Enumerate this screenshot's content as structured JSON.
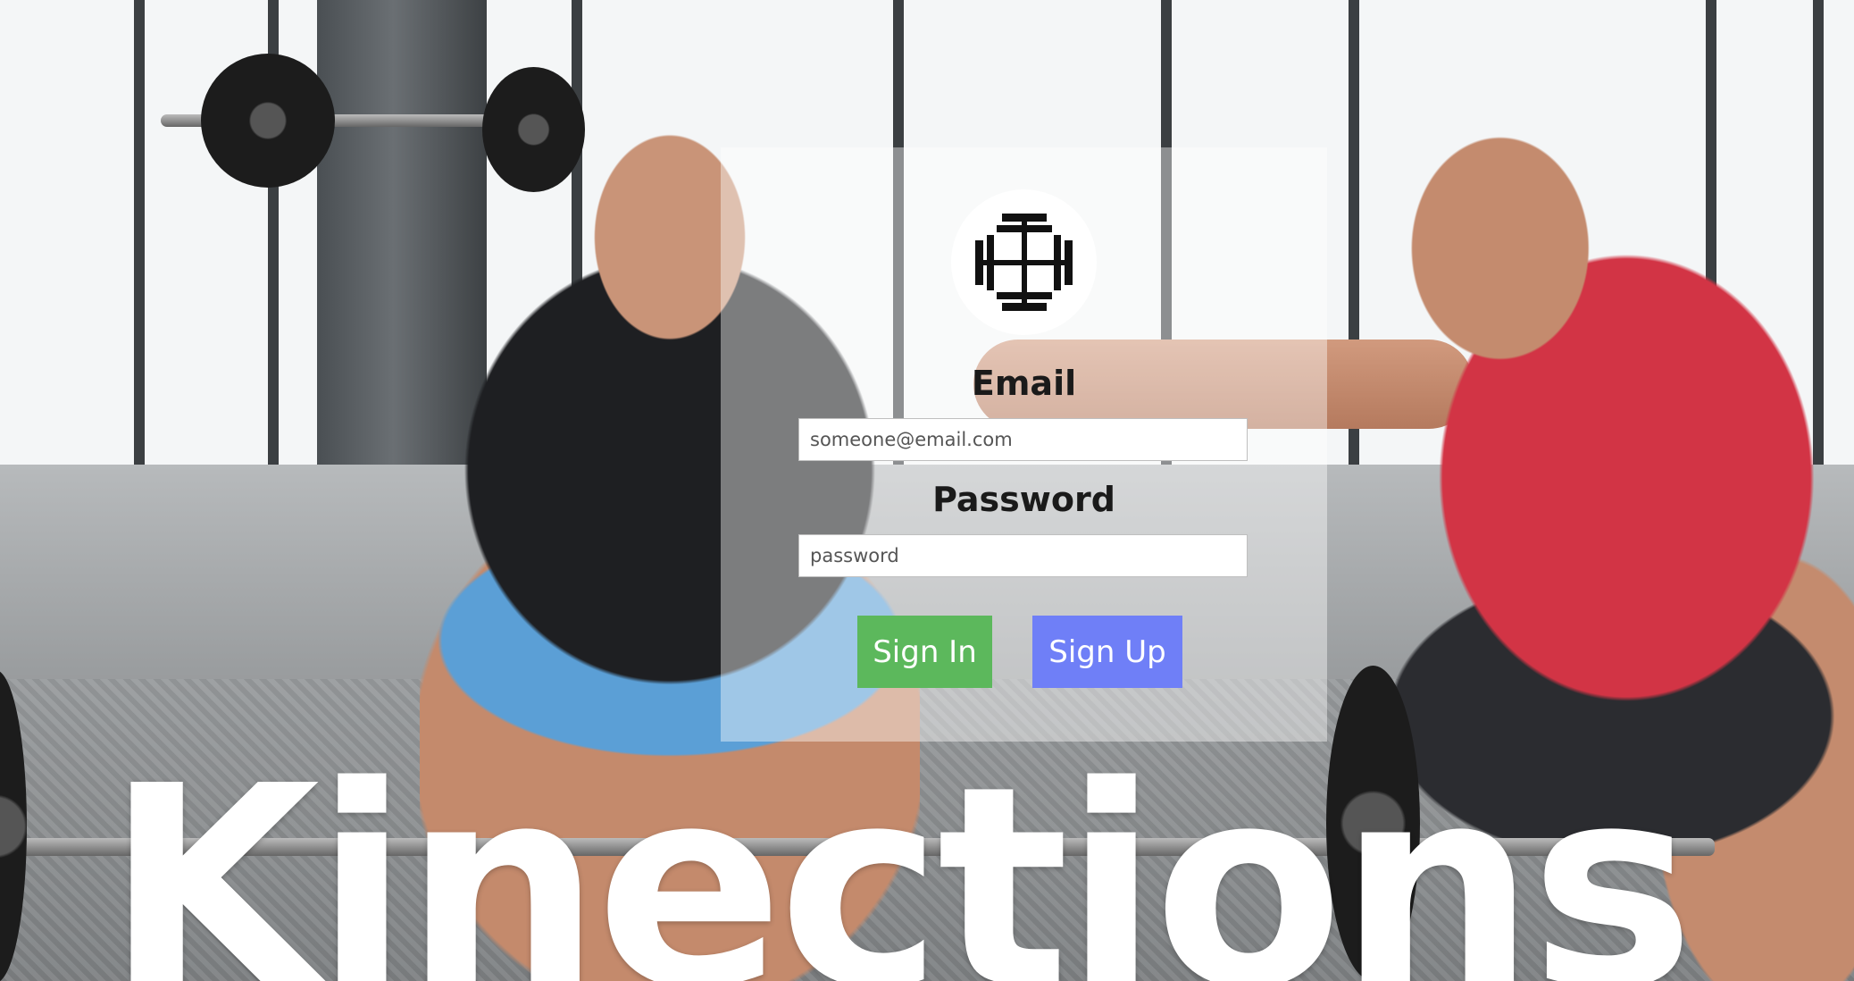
{
  "brand": {
    "wordmark": "Kinections"
  },
  "login": {
    "email_label": "Email",
    "email_placeholder": "someone@email.com",
    "email_value": "",
    "password_label": "Password",
    "password_placeholder": "password",
    "password_value": "",
    "signin_label": "Sign In",
    "signup_label": "Sign Up"
  },
  "icons": {
    "logo": "kinections-logo-icon"
  },
  "colors": {
    "signin_button": "#5cb85c",
    "signup_button": "#6f7ff7",
    "panel_overlay": "rgba(255,255,255,0.42)",
    "wordmark": "#ffffff"
  }
}
